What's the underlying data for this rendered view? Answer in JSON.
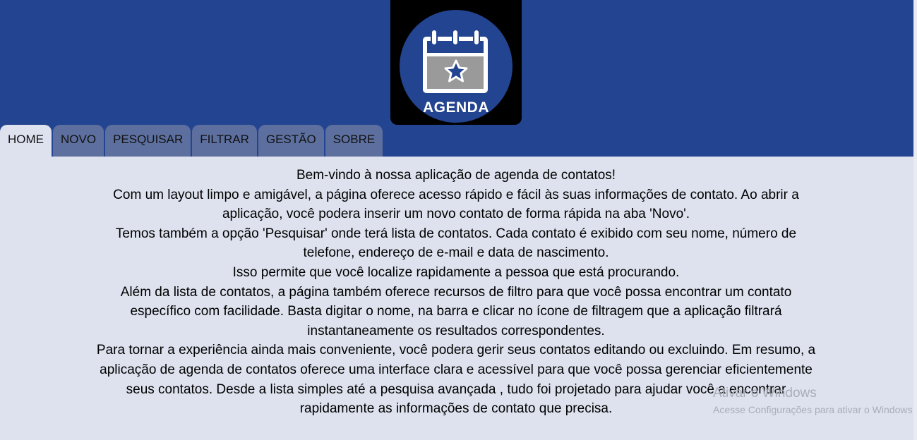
{
  "logo": {
    "label": "AGENDA",
    "icon": "calendar-star-icon",
    "colors": {
      "circle": "#234490",
      "calendar": "#9a9a9a",
      "outline": "#ffffff"
    }
  },
  "tabs": [
    {
      "label": "HOME",
      "active": true
    },
    {
      "label": "NOVO"
    },
    {
      "label": "PESQUISAR"
    },
    {
      "label": "FILTRAR"
    },
    {
      "label": "GESTÃO"
    },
    {
      "label": "SOBRE"
    }
  ],
  "content": {
    "paragraphs": [
      "Bem-vindo à nossa aplicação de agenda de contatos!",
      "Com um layout limpo e amigável, a página oferece acesso rápido e fácil às suas informações de contato. Ao abrir a aplicação, você podera inserir um novo contato de forma rápida na aba 'Novo'.",
      "Temos também a opção 'Pesquisar' onde terá lista de contatos. Cada contato é exibido com seu nome, número de telefone, endereço de e-mail e data de nascimento.",
      "Isso permite que você localize rapidamente a pessoa que está procurando.",
      "Além da lista de contatos, a página também oferece recursos de filtro para que você possa encontrar um contato específico com facilidade. Basta digitar o nome, na barra e clicar no ícone de filtragem que a aplicação filtrará instantaneamente os resultados correspondentes.",
      "Para tornar a experiência ainda mais conveniente, você podera gerir seus contatos editando ou excluindo. Em resumo, a aplicação de agenda de contatos oferece uma interface clara e acessível para que você possa gerenciar eficientemente seus contatos. Desde a lista simples até a pesquisa avançada , tudo foi projetado para ajudar você a encontrar rapidamente as informações de contato que precisa."
    ]
  },
  "watermark": {
    "title": "Ativar o Windows",
    "subtitle": "Acesse Configurações para ativar o Windows."
  },
  "colors": {
    "header": "#234490",
    "tab": "#5d6f9e",
    "content": "#dde2ee"
  }
}
